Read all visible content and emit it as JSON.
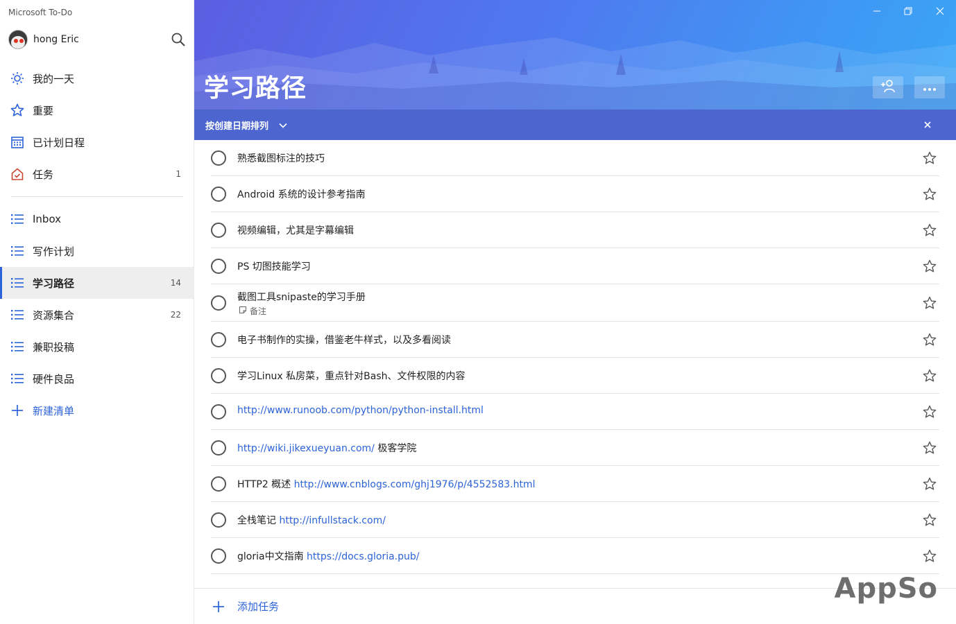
{
  "app": {
    "title": "Microsoft To-Do"
  },
  "user": {
    "name": "hong Eric"
  },
  "sidebar": {
    "smart_lists": [
      {
        "label": "我的一天",
        "icon": "sun-icon",
        "count": ""
      },
      {
        "label": "重要",
        "icon": "star-icon",
        "count": ""
      },
      {
        "label": "已计划日程",
        "icon": "calendar-icon",
        "count": ""
      },
      {
        "label": "任务",
        "icon": "home-icon",
        "count": "1"
      }
    ],
    "lists": [
      {
        "label": "Inbox",
        "count": ""
      },
      {
        "label": "写作计划",
        "count": ""
      },
      {
        "label": "学习路径",
        "count": "14",
        "active": true
      },
      {
        "label": "资源集合",
        "count": "22"
      },
      {
        "label": "兼职投稿",
        "count": ""
      },
      {
        "label": "硬件良品",
        "count": ""
      }
    ],
    "new_list_label": "新建清单"
  },
  "main": {
    "list_title": "学习路径",
    "sort_label": "按创建日期排列",
    "tasks": [
      {
        "text": "熟悉截图标注的技巧",
        "link": "",
        "suffix": ""
      },
      {
        "text": "Android 系统的设计参考指南",
        "link": "",
        "suffix": ""
      },
      {
        "text": "视频编辑，尤其是字幕编辑",
        "link": "",
        "suffix": ""
      },
      {
        "text": "PS 切图技能学习",
        "link": "",
        "suffix": ""
      },
      {
        "text": "截图工具snipaste的学习手册",
        "link": "",
        "suffix": "",
        "note": "备注"
      },
      {
        "text": "电子书制作的实操，借鉴老牛样式，以及多看阅读",
        "link": "",
        "suffix": ""
      },
      {
        "text": "学习Linux 私房菜，重点针对Bash、文件权限的内容",
        "link": "",
        "suffix": ""
      },
      {
        "text": "",
        "link": "http://www.runoob.com/python/python-install.html",
        "suffix": ""
      },
      {
        "text": "",
        "link": "http://wiki.jikexueyuan.com/",
        "suffix": " 极客学院"
      },
      {
        "text": "HTTP2 概述 ",
        "link": "http://www.cnblogs.com/ghj1976/p/4552583.html",
        "suffix": ""
      },
      {
        "text": "全栈笔记 ",
        "link": "http://infullstack.com/",
        "suffix": ""
      },
      {
        "text": "gloria中文指南 ",
        "link": "https://docs.gloria.pub/",
        "suffix": ""
      }
    ],
    "add_task_label": "添加任务"
  },
  "watermark": "AppSo",
  "colors": {
    "accent": "#2c63d9",
    "header_start": "#5b5ee0",
    "header_end": "#3aa6f5",
    "sortbar": "#4d66cf"
  }
}
